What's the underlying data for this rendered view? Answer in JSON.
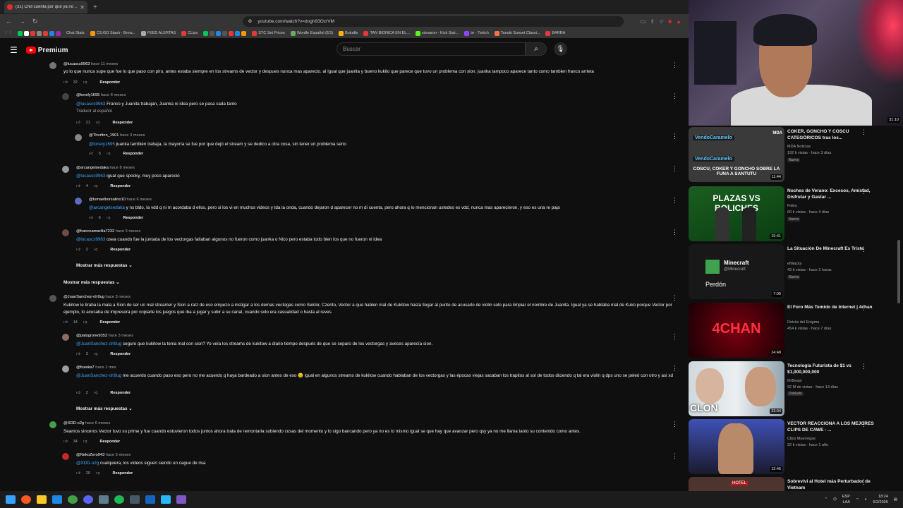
{
  "browser": {
    "tab_title": "(31) Chill cuenta por qué ya no ...",
    "url": "youtube.com/watch?v=dogh93OzrVM"
  },
  "bookmarks": [
    "Chat Stats",
    "CS:GO Stash - Brow...",
    "FEED ALERTAS",
    "CLips",
    "STC Set Prices",
    "Wordle Español (ES)",
    "Boludle",
    "TAN BIONICA EN EL...",
    "sionaron - Kick Stat...",
    "trr - Twitch",
    "Tanuki Sunset Classi...",
    "BARRA"
  ],
  "youtube": {
    "logo": "Premium",
    "search_placeholder": "Buscar"
  },
  "comments": [
    {
      "user": "@lucascs9963",
      "time": "hace 11 meses",
      "text": "yo lo que nunca supe que fue lo que paso con piru, antes estaba siempre en los streams de vector y despues nunca mas aparecio. al igual que juanita  y bueno kukito que parece que tuvo un problema con sion. juanka tampoco aparece tanto como tambien franco arrieta",
      "likes": "32",
      "reply": "Responder"
    },
    {
      "user": "@lonely1695",
      "time": "hace 6 meses",
      "mention": "@lucascs9963",
      "text": "Franco y Juanita trabajan, Juanka ni idea pero se pasa cada tanto",
      "translate": "Traducir al español",
      "likes": "21",
      "reply": "Responder"
    },
    {
      "user": "@Thorfinn_1901",
      "time": "hace 3 meses",
      "mention": "@lonely1695",
      "text": "juanka también trabaja, la mayoría se fue por que dejó el stream y se dedico a otra cosa, sin tener un problema serio",
      "likes": "5",
      "reply": "Responder"
    },
    {
      "user": "@arcangelsedaka",
      "time": "hace 8 meses",
      "mention": "@lucascs9963",
      "text": "igual que spooky, muy poco apareció",
      "likes": "4",
      "reply": "Responder"
    },
    {
      "user": "@Ismaelborsalino10",
      "time": "hace 6 meses",
      "mention": "@arcangelsedaka",
      "text": "y ns bldo, la vdd q ni m acordaba d ellos, pero si los vi en muchos videos y tda la onda, cuando dejaron d aparecer no m di cuenta, pero ahora q lo mencionan ustedes es vdd, nunca mas aparecieron, y eso es una re paja",
      "likes": "6",
      "reply": "Responder"
    },
    {
      "user": "@francoamarilla7232",
      "time": "hace 5 meses",
      "mention": "@lucascs9963",
      "text": "osea cuando fue la juntada de los vectorgas faltaban algunos no fueron como juanka o Nico pero estaba todo bien los que no fueron ni idea",
      "likes": "2",
      "reply": "Responder"
    },
    {
      "more_replies": "Mostrar más respuestas"
    },
    {
      "more_replies_top": "Mostrar más respuestas"
    },
    {
      "user": "@JuanSanchez-oh9ug",
      "time": "hace 3 meses",
      "text": "Kukitow le tiraba la mala a Sion de ser un mal streamer y Sion a raíz de eso empezo a instigar a los demas vectogas como Sektor, Czerito, Vector a que hablen mal de Kukitow hasta llegar al punto de acusarlo de violin solo para limpiar el nombre de Juanita. Igual ya se hablaba mal de Kuko porque Vector por ejemplo, lo acusaba de impresora por copiarle los juegos que iba a jugar y subir a su canal, cuando solo era casualidad o hasta al reves",
      "likes": "14",
      "reply": "Responder"
    },
    {
      "user": "@patogrone9353",
      "time": "hace 3 meses",
      "mention": "@JuanSanchez-oh9ug",
      "text": "seguro que kukitow la tenia mal con sion? Yo veía los streams de kukitow a diario tiempo después de que se separo de los vectorgas y aveces aparecía sion.",
      "likes": "3",
      "reply": "Responder"
    },
    {
      "user": "@fuseka7",
      "time": "hace 1 mes",
      "mention": "@JuanSanchez-oh9ug",
      "text": "me acuerdo cuando paso eso pero no me acuerdo q haya bardeado a sion antes de eso 😐 igual en algunos streams de kukitow cuando hablaban de los vectorgas y las épocas viejas sacaban los trapitos al sol de todos diciendo q tal era violin q dps uno se peleó con otro y asi xd",
      "likes": "2",
      "reply": "Responder"
    },
    {
      "more_replies2": "Mostrar más respuestas"
    },
    {
      "user": "@XDD-o2g",
      "time": "hace 6 meses",
      "text": "Seamos sinceros Vector tuvo su prime y fue cuando estuvieron todos juntos ahora trata de remontarla subiendo cosas del momento y lo sigo bancando pero ya no es lo mismo igual se que hay que avanzar pero qsy ya no me llama tanto su contenido como antes.",
      "likes": "34",
      "reply": "Responder"
    },
    {
      "user": "@NekoZero943",
      "time": "hace 5 meses",
      "mention": "@XDD-o2g",
      "text": "cualquiera, los videos siguen siendo un cague de risa",
      "likes": "20",
      "reply": "Responder"
    }
  ],
  "sidebar": [
    {
      "title": "COKER, GONCHO Y COSCU CATEGÓRICOS tras los...",
      "channel": "MDA Noticias",
      "views": "192 k vistas · hace 3 días",
      "badge": "Nuevo",
      "duration": "11:44",
      "thumb_text": "COSCU, COKER Y GONCHO SOBRE LA FUNA A SANTUTU",
      "overlay1": "VendoCaramelo",
      "overlay2": "VendoCaramelo",
      "brand": "MDA"
    },
    {
      "title": "Noches de Verano: Excesos, Amistad, Disfrutar y Gastar ...",
      "channel": "Fides",
      "views": "60 k vistas · hace 4 días",
      "badge": "Nuevo",
      "duration": "15:41",
      "thumb_text": "PLAZAS VS BOLICHES"
    },
    {
      "title": "La Situación De Minecraft Es Triste",
      "channel": "elWacky",
      "views": "43 k vistas · hace 2 horas",
      "badge": "Nuevo",
      "duration": "7:00",
      "thumb_text": "Minecraft",
      "thumb_sub": "@Minecraft",
      "thumb_word": "Perdón"
    },
    {
      "title": "El Foro Más Temido de Internet | 4chan",
      "channel": "Detrás del Enigma",
      "views": "454 k vistas · hace 7 días",
      "duration": "24:48",
      "thumb_text": "4CHAN"
    },
    {
      "title": "Tecnología Futurista de $1 vs $1,000,000,000",
      "channel": "MrBeast",
      "views": "92 M de vistas · hace 13 días",
      "badge": "Doblado",
      "duration": "23:04",
      "thumb_text": "CLON"
    },
    {
      "title": "VECTOR REACCIONA A LOS MEJORES CLIPS DE CAWE - ...",
      "channel": "Clips Muerregas",
      "views": "22 k vistas · hace 1 año",
      "duration": "12:45"
    },
    {
      "title": "Sobrevivi al Hotel más Perturbador de Vietnam",
      "thumb_text": "HOTEL"
    }
  ],
  "cam": {
    "overlay": "31:10"
  },
  "taskbar": {
    "lang": "ESP",
    "lang2": "LAA",
    "time": "18:24",
    "date": "6/2/2026"
  },
  "colors": {
    "bg": "#0f0f0f",
    "mention": "#3ea6ff",
    "yt_red": "#ff0000"
  }
}
